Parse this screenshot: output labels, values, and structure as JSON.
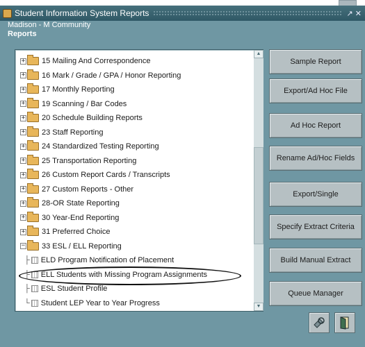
{
  "window": {
    "title": "Student Information System Reports",
    "controls": "↗ ✕"
  },
  "org_name": "Madison - M Community",
  "section_title": "Reports",
  "tree": {
    "categories": [
      {
        "label": "15 Mailing And Correspondence",
        "expander": "+"
      },
      {
        "label": "16 Mark / Grade / GPA / Honor Reporting",
        "expander": "+"
      },
      {
        "label": "17 Monthly Reporting",
        "expander": "+"
      },
      {
        "label": "19 Scanning / Bar Codes",
        "expander": "+"
      },
      {
        "label": "20 Schedule Building Reports",
        "expander": "+"
      },
      {
        "label": "23 Staff Reporting",
        "expander": "+"
      },
      {
        "label": "24 Standardized Testing Reporting",
        "expander": "+"
      },
      {
        "label": "25 Transportation Reporting",
        "expander": "+"
      },
      {
        "label": "26 Custom Report Cards / Transcripts",
        "expander": "+"
      },
      {
        "label": "27 Custom Reports - Other",
        "expander": "+"
      },
      {
        "label": "28-OR State Reporting",
        "expander": "+"
      },
      {
        "label": "30 Year-End Reporting",
        "expander": "+"
      },
      {
        "label": "31 Preferred Choice",
        "expander": "+"
      },
      {
        "label": "33 ESL / ELL Reporting",
        "expander": "−"
      }
    ],
    "children": [
      {
        "label": "ELD Program Notification of Placement",
        "connector": "├"
      },
      {
        "label": "ELL Students with Missing Program Assignments",
        "connector": "├"
      },
      {
        "label": "ESL Student Profile",
        "connector": "├"
      },
      {
        "label": "Student LEP Year to Year Progress",
        "connector": "└"
      }
    ]
  },
  "buttons": {
    "sample_report": "Sample Report",
    "export_adhoc_file": "Export/Ad Hoc File",
    "adhoc_report": "Ad Hoc Report",
    "rename_adhoc_fields": "Rename Ad/Hoc Fields",
    "export_single": "Export/Single",
    "specify_extract": "Specify Extract Criteria",
    "build_manual_extract": "Build Manual Extract",
    "queue_manager": "Queue Manager"
  },
  "icons": {
    "settings": "settings-icon",
    "exit": "exit-door-icon"
  }
}
